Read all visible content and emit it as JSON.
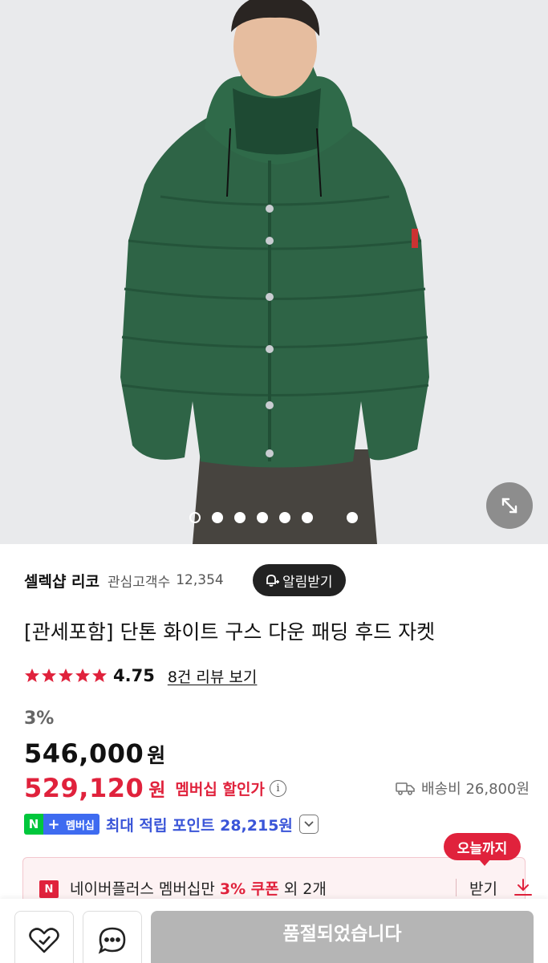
{
  "hero": {
    "image_alt": "",
    "slide_count": 8,
    "active_slide": 1,
    "zoom_icon": "expand-arrows-icon"
  },
  "store": {
    "name": "셀렉샵 리코",
    "fans_label": "관심고객수",
    "fans_count": "12,354",
    "alarm_button": "알림받기",
    "alarm_icon": "bell-plus-icon"
  },
  "product": {
    "title": "[관세포함] 단톤 화이트 구스 다운 패딩 후드 자켓",
    "rating": {
      "stars": 5,
      "value": "4.75",
      "review_link": "8건 리뷰 보기"
    },
    "price": {
      "discount": "3%",
      "original": "546,000",
      "original_unit": "원",
      "sale": "529,120",
      "sale_unit": "원",
      "sale_label": "멤버십 할인가",
      "info_icon": "info-icon"
    },
    "shipping": {
      "label": "배송비 26,800원",
      "icon": "truck-icon"
    },
    "points": {
      "badge_n": "N",
      "badge_plus": "+",
      "badge_label": "멤버십",
      "text": "최대 적립 포인트 28,215원"
    },
    "coupon": {
      "tag": "오늘까지",
      "badge": "N",
      "text_prefix": "네이버플러스 멤버십만 ",
      "text_highlight": "3% 쿠폰",
      "text_suffix": " 외 2개",
      "get_label": "받기",
      "icon": "download-icon"
    }
  },
  "bottom_bar": {
    "like_icon": "heart-check-icon",
    "chat_icon": "chat-bubble-icon",
    "soldout_label": "품절되었습니다"
  },
  "colors": {
    "accent_red": "#e0223c",
    "membership_blue": "#3a55d8",
    "naver_green": "#00c73c",
    "jacket_green": "#2e6446"
  }
}
